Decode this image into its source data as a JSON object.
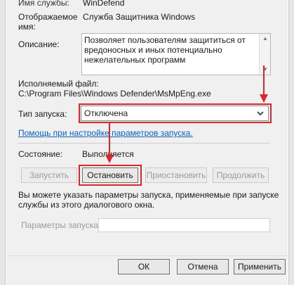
{
  "properties": {
    "service_name": {
      "label": "Имя службы:",
      "value": "WinDefend"
    },
    "display_name": {
      "label_line1": "Отображаемое",
      "label_line2": "имя:",
      "value": "Служба Защитника Windows"
    },
    "description": {
      "label": "Описание:",
      "line1": "Позволяет пользователям защититься от",
      "line2": "вредоносных и иных потенциально",
      "line3": "нежелательных программ"
    },
    "executable": {
      "label": "Исполняемый файл:",
      "value": "C:\\Program Files\\Windows Defender\\MsMpEng.exe"
    },
    "startup_type": {
      "label": "Тип запуска:",
      "selected": "Отключена"
    },
    "help_link": "Помощь при настройке параметров запуска.",
    "status": {
      "label": "Состояние:",
      "value": "Выполняется"
    }
  },
  "control_buttons": {
    "start": "Запустить",
    "stop": "Остановить",
    "pause": "Приостановить",
    "resume": "Продолжить"
  },
  "hint": {
    "line1": "Вы можете указать параметры запуска, применяемые при запуске",
    "line2": "службы из этого диалогового окна."
  },
  "start_params": {
    "label": "Параметры запуска:",
    "value": ""
  },
  "dialog_buttons": {
    "ok": "ОК",
    "cancel": "Отмена",
    "apply": "Применить"
  },
  "colors": {
    "highlight": "#e0242c",
    "link": "#0b5fbf"
  }
}
